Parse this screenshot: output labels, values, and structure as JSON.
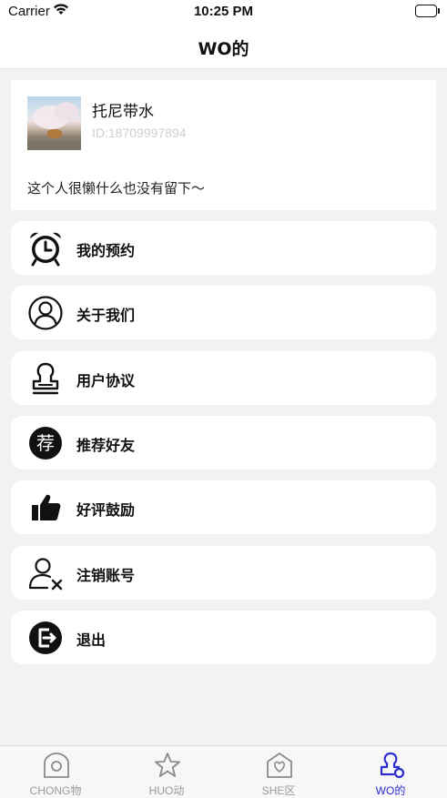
{
  "status_bar": {
    "carrier": "Carrier",
    "time": "10:25 PM"
  },
  "nav": {
    "title": "WO的"
  },
  "profile": {
    "name": "托尼带水",
    "id": "ID:18709997894",
    "bio": "这个人很懒什么也没有留下～"
  },
  "menu": [
    {
      "label": "我的预约",
      "icon": "alarm-clock-icon"
    },
    {
      "label": "关于我们",
      "icon": "user-circle-icon"
    },
    {
      "label": "用户协议",
      "icon": "stamp-icon"
    },
    {
      "label": "推荐好友",
      "icon": "recommend-icon"
    },
    {
      "label": "好评鼓励",
      "icon": "thumbs-up-icon"
    },
    {
      "label": "注销账号",
      "icon": "user-remove-icon"
    },
    {
      "label": "退出",
      "icon": "exit-icon"
    }
  ],
  "tabs": [
    {
      "label": "CHONG物",
      "icon": "house-icon",
      "active": false
    },
    {
      "label": "HUO动",
      "icon": "star-icon",
      "active": false
    },
    {
      "label": "SHE区",
      "icon": "heart-house-icon",
      "active": false
    },
    {
      "label": "WO的",
      "icon": "stamp-person-icon",
      "active": true
    }
  ],
  "colors": {
    "accent": "#2c2ccf",
    "background": "#f2f2f2",
    "inactive_tab": "#9a9a9a"
  },
  "icon_text": {
    "recommend": "荐"
  }
}
